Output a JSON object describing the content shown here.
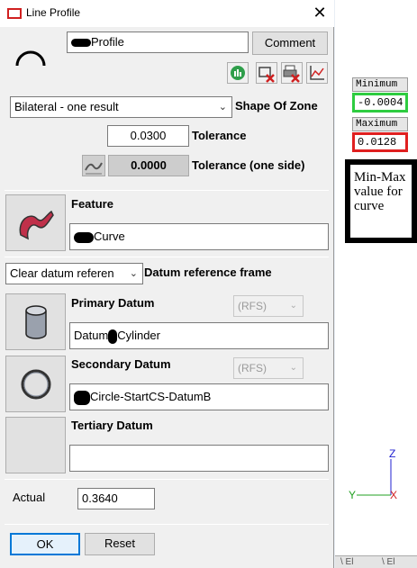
{
  "window": {
    "title": "Line Profile",
    "close_symbol": "✕"
  },
  "header": {
    "name_value": "Profile",
    "comment_label": "Comment",
    "toolbar_icons": [
      "report-icon",
      "delete-bar-icon",
      "delete-print-icon",
      "graph-icon"
    ]
  },
  "zone": {
    "shape_selected": "Bilateral - one result",
    "shape_label": "Shape Of Zone",
    "tolerance_value": "0.0300",
    "tolerance_label": "Tolerance",
    "one_side_value": "0.0000",
    "one_side_label": "Tolerance (one side)"
  },
  "feature": {
    "label": "Feature",
    "value": "Curve"
  },
  "datum": {
    "ref_selected": "Clear datum referen",
    "ref_label": "Datum reference frame",
    "primary_label": "Primary Datum",
    "primary_modifier": "(RFS)",
    "primary_value_pre": "Datum",
    "primary_value_post": "Cylinder",
    "secondary_label": "Secondary Datum",
    "secondary_modifier": "(RFS)",
    "secondary_value": "Circle-StartCS-DatumB",
    "tertiary_label": "Tertiary Datum",
    "tertiary_value": ""
  },
  "actual": {
    "label": "Actual",
    "value": "0.3640"
  },
  "buttons": {
    "ok": "OK",
    "reset": "Reset"
  },
  "viewport": {
    "min_label": "Minimum",
    "min_value": "-0.0004",
    "max_label": "Maximum",
    "max_value": "0.0128",
    "note_lines": [
      "Min-Max",
      "value for",
      "curve"
    ],
    "axis_z": "Z",
    "axis_y": "Y",
    "axis_x": "X",
    "bottom_tabs": [
      "\\ El",
      "\\ El"
    ],
    "colors": {
      "min_border": "#2ecc40",
      "max_border": "#e02020"
    }
  }
}
